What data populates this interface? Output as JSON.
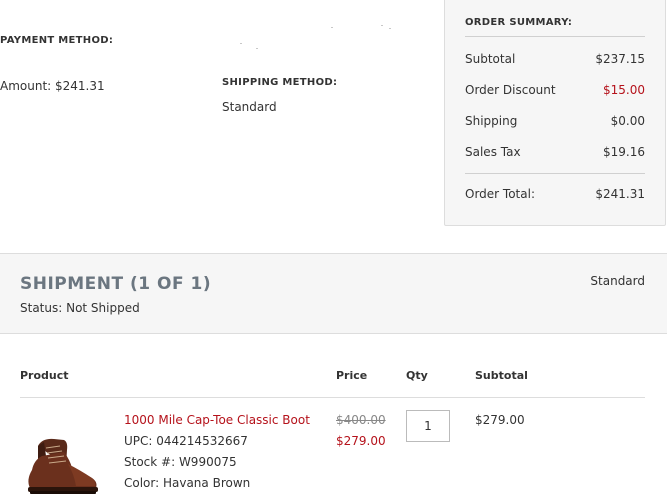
{
  "payment": {
    "label": "PAYMENT METHOD:",
    "amount": "Amount: $241.31"
  },
  "shipping": {
    "label": "SHIPPING METHOD:",
    "value": "Standard"
  },
  "order_summary": {
    "title": "ORDER SUMMARY:",
    "rows": [
      {
        "label": "Subtotal",
        "value": "$237.15"
      },
      {
        "label": "Order Discount",
        "value": "$15.00"
      },
      {
        "label": "Shipping",
        "value": "$0.00"
      },
      {
        "label": "Sales Tax",
        "value": "$19.16"
      }
    ],
    "total_label": "Order Total:",
    "total_value": "$241.31"
  },
  "shipment": {
    "title": "SHIPMENT (1 OF 1)",
    "status": "Status: Not Shipped",
    "method": "Standard"
  },
  "table": {
    "headers": {
      "product": "Product",
      "price": "Price",
      "qty": "Qty",
      "subtotal": "Subtotal"
    }
  },
  "item": {
    "name": "1000 Mile Cap-Toe Classic Boot",
    "upc": "UPC: 044214532667",
    "stock": "Stock #: W990075",
    "color": "Color: Havana Brown",
    "price_original": "$400.00",
    "price_sale": "$279.00",
    "qty": "1",
    "subtotal": "$279.00"
  },
  "colors": {
    "accent_red": "#b5121b",
    "panel_bg": "#f6f6f6",
    "shipment_title": "#6b7680"
  }
}
